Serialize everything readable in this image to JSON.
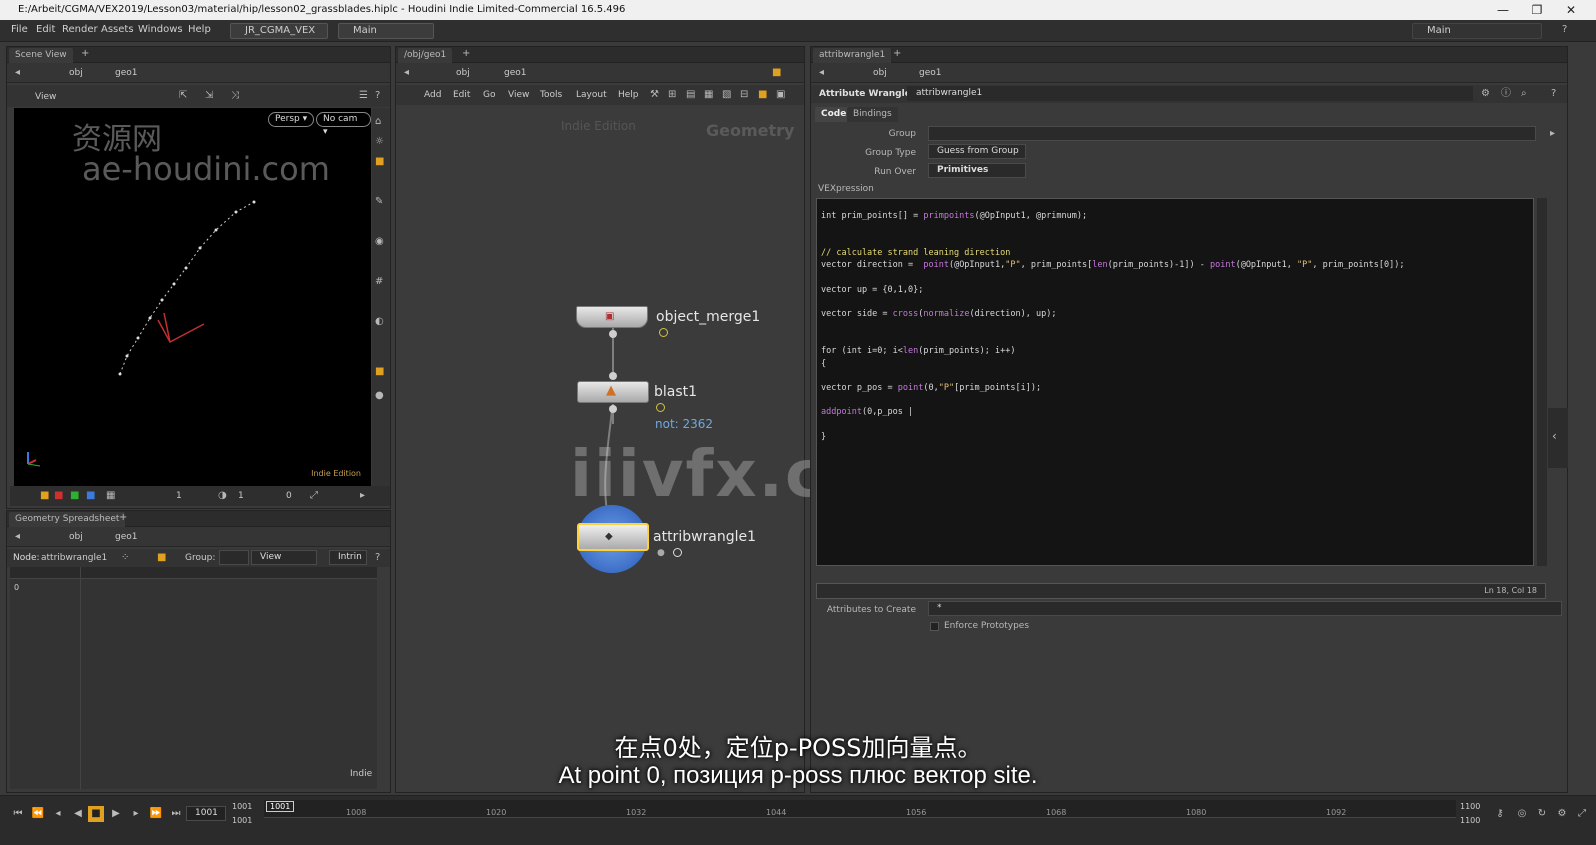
{
  "window": {
    "title": "E:/Arbeit/CGMA/VEX2019/Lesson03/material/hip/lesson02_grassblades.hiplc - Houdini Indie Limited-Commercial 16.5.496",
    "minimize": "—",
    "maximize": "❐",
    "close": "✕"
  },
  "menubar": {
    "items": [
      "File",
      "Edit",
      "Render",
      "Assets",
      "Windows",
      "Help"
    ],
    "shelf_set": "JR_CGMA_VEX",
    "desktop": "Main",
    "desktop_right": "Main"
  },
  "scene_view": {
    "tab": "Scene View",
    "path_root": "obj",
    "path_node": "geo1",
    "view_label": "View",
    "persp": "Persp ▾",
    "cam": "No cam ▾",
    "edition": "Indie Edition",
    "watermark_cn": "资源网",
    "watermark_url": "ae-houdini.com",
    "bottom_val1": "1",
    "bottom_val2": "1",
    "bottom_val3": "0"
  },
  "spreadsheet": {
    "tab": "Geometry Spreadsheet",
    "path_root": "obj",
    "path_node": "geo1",
    "node_label": "Node:",
    "node_name": "attribwrangle1",
    "group_label": "Group:",
    "view_btn": "View",
    "intrin_btn": "Intrin",
    "row0": "0",
    "footer": "Indie"
  },
  "network": {
    "tab": "/obj/geo1",
    "path_root": "obj",
    "path_node": "geo1",
    "menu": [
      "Add",
      "Edit",
      "Go",
      "View",
      "Tools",
      "Layout",
      "Help"
    ],
    "edition_text": "Indie Edition",
    "context": "Geometry",
    "nodes": {
      "n1": "object_merge1",
      "n2": "blast1",
      "n2_info": "not: 2362",
      "n3": "attribwrangle1"
    },
    "watermark": "iiivfx.com"
  },
  "params": {
    "tab": "attribwrangle1",
    "path_root": "obj",
    "path_node": "geo1",
    "node_type": "Attribute Wrangle",
    "node_name": "attribwrangle1",
    "tabs": [
      "Code",
      "Bindings"
    ],
    "group_label": "Group",
    "group_value": "",
    "group_type_label": "Group Type",
    "group_type_value": "Guess from Group",
    "run_over_label": "Run Over",
    "run_over_value": "Primitives",
    "vex_label": "VEXpression",
    "code": {
      "l1a": "int prim_points[] = ",
      "l1b": "primpoints",
      "l1c": "(@OpInput1, @primnum);",
      "l2": "// calculate strand leaning direction",
      "l3a": "vector direction =  ",
      "l3b": "point",
      "l3c": "(@OpInput1,",
      "l3d": "\"P\"",
      "l3e": ", prim_points[",
      "l3f": "len",
      "l3g": "(prim_points)-1]) - ",
      "l3h": "point",
      "l3i": "(@OpInput1, ",
      "l3j": "\"P\"",
      "l3k": ", prim_points[0]);",
      "l4": "vector up = {0,1,0};",
      "l5a": "vector side = ",
      "l5b": "cross",
      "l5c": "(",
      "l5d": "normalize",
      "l5e": "(direction), up);",
      "l6a": "for (int i=0; i<",
      "l6b": "len",
      "l6c": "(prim_points); i++)",
      "l7": "{",
      "l8a": "vector p_pos = ",
      "l8b": "point",
      "l8c": "(0,",
      "l8d": "\"P\"",
      "l8e": "[prim_points[i]);",
      "l9a": "addpoint",
      "l9b": "(0,p_pos |",
      "l10": "}"
    },
    "cursor_pos": "Ln 18, Col 18",
    "attrs_label": "Attributes to Create",
    "attrs_value": "*",
    "enforce_label": "Enforce Prototypes"
  },
  "timeline": {
    "current_frame": "1001",
    "start": "1001",
    "start2": "1001",
    "frame_field": "1001",
    "ticks": [
      "1008",
      "1020",
      "1032",
      "1044",
      "1056",
      "1068",
      "1080",
      "1092"
    ],
    "end": "1100",
    "end2": "1100"
  },
  "subtitles": {
    "cn": "在点0处，定位p-POSS加向量点。",
    "ru": "At point 0, позиция p-poss плюс вектор site."
  }
}
